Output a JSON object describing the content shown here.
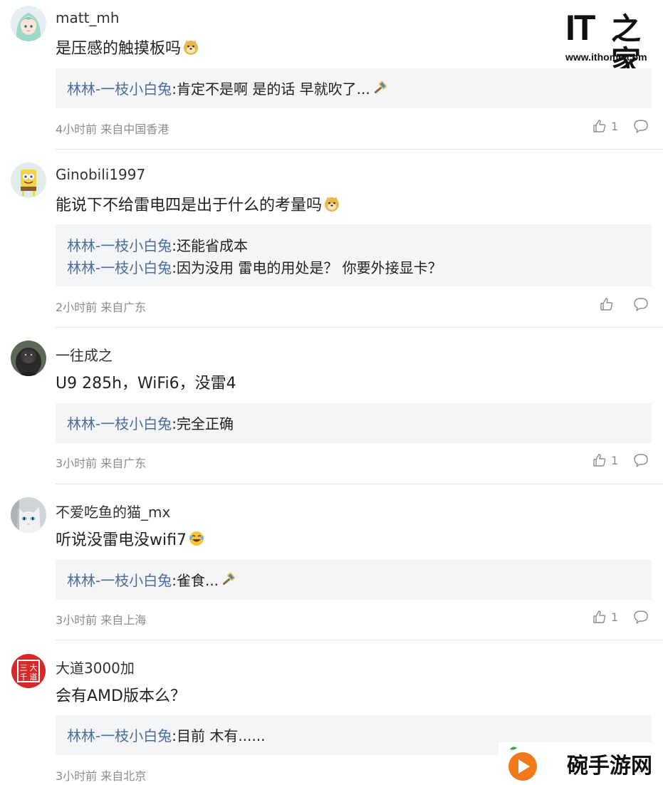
{
  "site_logo": {
    "mark": "IT",
    "zh": "之家",
    "url": "www.ithome.com"
  },
  "watermark": {
    "text": "碗手游网",
    "icon": "orange-play-logo-icon"
  },
  "comments": [
    {
      "username": "matt_mh",
      "avatar_icon": "anime-girl-avatar",
      "content": "是压感的触摸板吗",
      "content_emoji": "doge-emoji",
      "replies": [
        {
          "user": "林林-一枝小白兔",
          "text": ":肯定不是啊 是的话 早就吹了...",
          "emoji": "hammer-emoji"
        }
      ],
      "meta": "4小时前 来自中国香港",
      "likes": "1"
    },
    {
      "username": "Ginobili1997",
      "avatar_icon": "spongebob-avatar",
      "content": "能说下不给雷电四是出于什么的考量吗",
      "content_emoji": "doge-emoji",
      "replies": [
        {
          "user": "林林-一枝小白兔",
          "text": ":还能省成本"
        },
        {
          "user": "林林-一枝小白兔",
          "text": ":因为没用 雷电的用处是？ 你要外接显卡？"
        }
      ],
      "meta": "2小时前 来自广东",
      "likes": ""
    },
    {
      "username": "一往成之",
      "avatar_icon": "gorilla-avatar",
      "content": "U9 285h，WiFi6，没雷4",
      "replies": [
        {
          "user": "林林-一枝小白兔",
          "text": ":完全正确"
        }
      ],
      "meta": "3小时前 来自广东",
      "likes": "1"
    },
    {
      "username": "不爱吃鱼的猫_mx",
      "avatar_icon": "white-cat-avatar",
      "content": "听说没雷电没wifi7",
      "content_emoji": "laughing-tears-emoji",
      "replies": [
        {
          "user": "林林-一枝小白兔",
          "text": ":雀食...",
          "emoji": "hammer-emoji"
        }
      ],
      "meta": "3小时前 来自上海",
      "likes": "1"
    },
    {
      "username": "大道3000加",
      "avatar_icon": "red-seal-avatar",
      "avatar_text": "三大千道",
      "content": "会有AMD版本么？",
      "replies": [
        {
          "user": "林林-一枝小白兔",
          "text": ":目前 木有......"
        }
      ],
      "meta": "3小时前 来自北京",
      "likes": ""
    }
  ]
}
